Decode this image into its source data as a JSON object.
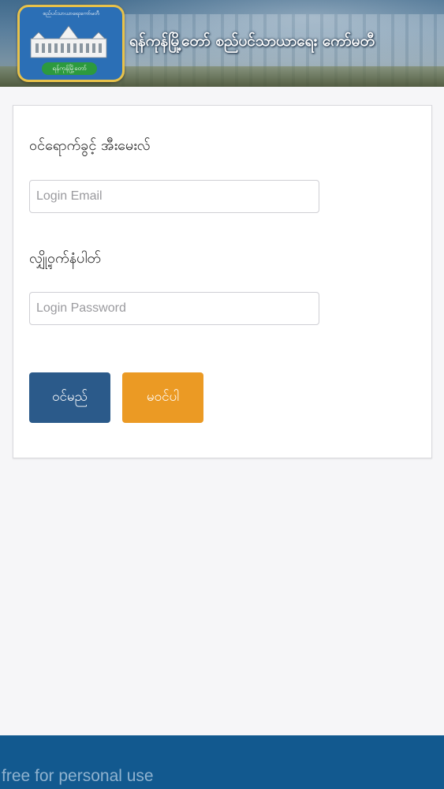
{
  "header": {
    "title": "ရန်ကုန်မြို့တော် စည်ပင်သာယာရေး ကော်မတီ",
    "logo": {
      "top_text": "စည်ပင်သာယာရေးကော်မတီ",
      "band_text": "ရန်ကုန်မြို့တော်",
      "colors": {
        "blue": "#2b6fb6",
        "gold": "#e8c24a",
        "green": "#2c9a3e"
      }
    }
  },
  "form": {
    "email_label": "ဝင်ရောက်ခွင့် အီးမေးလ်",
    "email_placeholder": "Login Email",
    "email_value": "",
    "password_label": "လျှို့ဝှက်နံပါတ်",
    "password_placeholder": "Login Password",
    "password_value": "",
    "login_button": "ဝင်မည်",
    "cancel_button": "မဝင်ပါ",
    "colors": {
      "login": "#2b5a8a",
      "cancel": "#eb9a24"
    }
  },
  "footer": {
    "text": "free for personal use",
    "color": "#12598f"
  }
}
